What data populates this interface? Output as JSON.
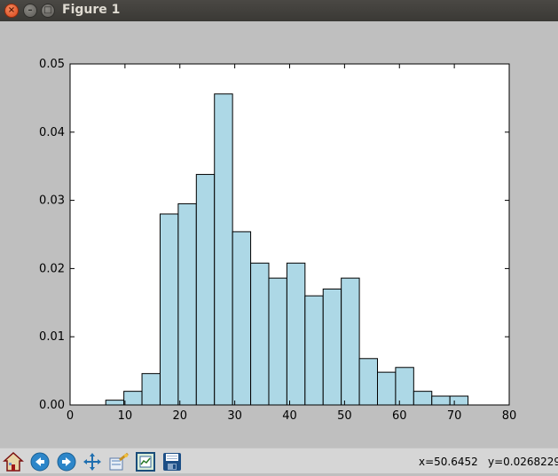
{
  "window": {
    "title": "Figure 1",
    "buttons": {
      "close": "×",
      "minimize": "–",
      "maximize": "□"
    }
  },
  "colors": {
    "bar_fill": "#add8e6",
    "bar_edge": "#000000",
    "figure_bg": "#bfbfbf",
    "axes_bg": "#ffffff",
    "titlebar": "#3c3b37"
  },
  "chart_data": {
    "type": "bar",
    "title": "",
    "xlabel": "",
    "ylabel": "",
    "xlim": [
      0,
      80
    ],
    "ylim": [
      0,
      0.05
    ],
    "xticks": [
      0,
      10,
      20,
      30,
      40,
      50,
      60,
      70,
      80
    ],
    "xtick_labels": [
      "0",
      "10",
      "20",
      "30",
      "40",
      "50",
      "60",
      "70",
      "80"
    ],
    "yticks": [
      0,
      0.01,
      0.02,
      0.03,
      0.04,
      0.05
    ],
    "ytick_labels": [
      "0.00",
      "0.01",
      "0.02",
      "0.03",
      "0.04",
      "0.05"
    ],
    "grid": false,
    "legend": "none",
    "bin_edges": [
      6.5,
      9.8,
      13.1,
      16.4,
      19.7,
      23.0,
      26.3,
      29.6,
      32.9,
      36.2,
      39.5,
      42.8,
      46.1,
      49.4,
      52.7,
      56.0,
      59.3,
      62.6,
      65.9,
      69.2,
      72.5
    ],
    "values": [
      0.0007,
      0.002,
      0.0046,
      0.028,
      0.0295,
      0.0338,
      0.0456,
      0.0254,
      0.0208,
      0.0186,
      0.0208,
      0.016,
      0.017,
      0.0186,
      0.0068,
      0.0048,
      0.0055,
      0.002,
      0.0013,
      0.0013
    ]
  },
  "toolbar": {
    "tools": [
      {
        "name": "home-icon",
        "label": "Home"
      },
      {
        "name": "back-icon",
        "label": "Back"
      },
      {
        "name": "forward-icon",
        "label": "Forward"
      },
      {
        "name": "pan-icon",
        "label": "Pan"
      },
      {
        "name": "zoom-icon",
        "label": "Zoom"
      },
      {
        "name": "subplots-icon",
        "label": "Configure subplots"
      },
      {
        "name": "save-icon",
        "label": "Save"
      }
    ],
    "coords": {
      "x": "x=50.6452",
      "y": "y=0.0268229"
    }
  }
}
